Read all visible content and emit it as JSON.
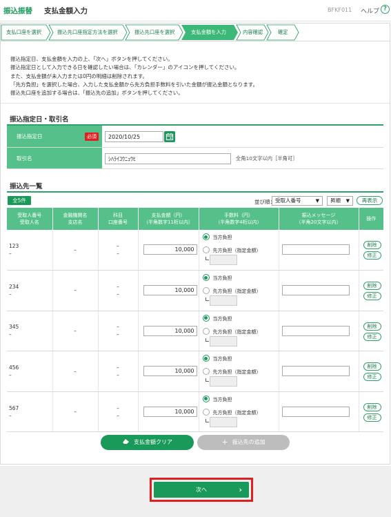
{
  "header": {
    "brand": "振込振替",
    "title": "支払金額入力",
    "screen_code": "BFKF011",
    "help_label": "ヘルプ",
    "help_icon": "?"
  },
  "steps": [
    {
      "label": "支払口座を選択",
      "active": false
    },
    {
      "label": "振込先口座指定方法を選択",
      "active": false
    },
    {
      "label": "振込先口座を選択",
      "active": false
    },
    {
      "label": "支払金額を入力",
      "active": true
    },
    {
      "label": "内容確認",
      "active": false
    },
    {
      "label": "確定",
      "active": false
    }
  ],
  "intro_lines": [
    "振込指定日、支払金額を入力の上、「次へ」ボタンを押してください。",
    "振込指定日として入力できる日を確認したい場合は、「カレンダー」のアイコンを押してください。",
    "また、支払金額が未入力または0円の明細は削除されます。",
    "「先方負担」を選択した場合、入力した支払金額から先方負担手数料を引いた金額が振込金額となります。",
    "振込先口座を追加する場合は、「振込先の追加」ボタンを押してください。"
  ],
  "section1": {
    "title": "振込指定日・取引名",
    "date_label": "振込指定日",
    "required": "必須",
    "date_value": "2020/10/25",
    "tx_label": "取引名",
    "tx_value": "ｼﾊﾗｲｺｳﾆｭｳﾋ",
    "tx_note": "全角10文字以内［半角可］"
  },
  "section2": {
    "title": "振込先一覧",
    "count": "全5件",
    "sort_label": "並び順：",
    "sort_field": "受取人番号",
    "sort_order": "昇順",
    "redisplay": "再表示"
  },
  "table": {
    "headers": [
      [
        "受取人番号",
        "受取人名"
      ],
      [
        "金融機関名",
        "支店名"
      ],
      [
        "科目",
        "口座番号"
      ],
      [
        "支払金額（円）",
        "（半角数字11桁以内）"
      ],
      [
        "手数料（円）",
        "（半角数字4桁以内）"
      ],
      [
        "振込メッセージ",
        "（半角20文字以内）"
      ],
      [
        "操作"
      ]
    ],
    "rows": [
      {
        "id": "123",
        "name": "–",
        "bank": "–",
        "subject": "–",
        "account": "–",
        "amount": "10,000",
        "fee_option1": "当方負担",
        "fee_option2": "先方負担（指定金額）",
        "delete": "削除",
        "edit": "修正"
      },
      {
        "id": "234",
        "name": "–",
        "bank": "–",
        "subject": "–",
        "account": "–",
        "amount": "10,000",
        "fee_option1": "当方負担",
        "fee_option2": "先方負担（指定金額）",
        "delete": "削除",
        "edit": "修正"
      },
      {
        "id": "345",
        "name": "–",
        "bank": "–",
        "subject": "–",
        "account": "–",
        "amount": "10,000",
        "fee_option1": "当方負担",
        "fee_option2": "先方負担（指定金額）",
        "delete": "削除",
        "edit": "修正"
      },
      {
        "id": "456",
        "name": "–",
        "bank": "–",
        "subject": "–",
        "account": "–",
        "amount": "10,000",
        "fee_option1": "当方負担",
        "fee_option2": "先方負担（指定金額）",
        "delete": "削除",
        "edit": "修正"
      },
      {
        "id": "567",
        "name": "–",
        "bank": "–",
        "subject": "–",
        "account": "–",
        "amount": "10,000",
        "fee_option1": "当方負担",
        "fee_option2": "先方負担（指定金額）",
        "delete": "削除",
        "edit": "修正"
      }
    ]
  },
  "buttons": {
    "clear": "支払金額クリア",
    "add": "振込先の追加",
    "next": "次へ"
  },
  "colors": {
    "accent": "#1a9a5a",
    "header_cell": "#56c08a",
    "highlight": "#e02020"
  }
}
